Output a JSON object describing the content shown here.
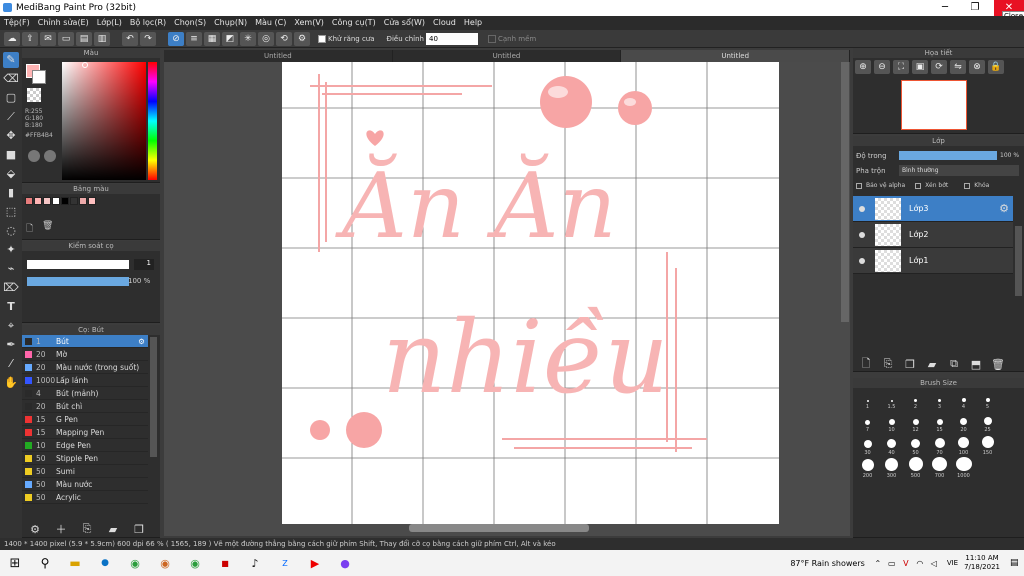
{
  "window": {
    "title": "MediBang Paint Pro (32bit)",
    "close_tooltip": "Close"
  },
  "menu": [
    "Tệp(F)",
    "Chỉnh sửa(E)",
    "Lớp(L)",
    "Bộ lọc(R)",
    "Chọn(S)",
    "Chụp(N)",
    "Màu (C)",
    "Xem(V)",
    "Công cụ(T)",
    "Cửa sổ(W)",
    "Cloud",
    "Help"
  ],
  "toolbar": {
    "antialias_label": "Khử răng cưa",
    "adjust_label": "Điều chỉnh",
    "adjust_value": "40",
    "edge_label": "Cạnh mềm"
  },
  "tabs": [
    "Untitled",
    "Untitled",
    "Untitled"
  ],
  "color_panel": {
    "title": "Màu",
    "r": "R:255",
    "g": "G:180",
    "b": "B:180",
    "hex": "#FFB4B4",
    "fg_color": "#ffb4b4",
    "bg_color": "#ffffff"
  },
  "palette_panel": {
    "title": "Bảng màu",
    "swatches": [
      "#e77c7c",
      "#ffb4b4",
      "#f6c6c6",
      "#ffffff",
      "#000000",
      "#333333",
      "#eeaaaa",
      "#ffc0c0"
    ]
  },
  "brush_control": {
    "title": "Kiểm soát cọ",
    "size": "1",
    "opacity": "100 %"
  },
  "brush_panel": {
    "title": "Cọ: Bút",
    "items": [
      {
        "size": "1",
        "name": "Bút",
        "color": "#2a2a2a",
        "active": true
      },
      {
        "size": "20",
        "name": "Mờ",
        "color": "#ff66aa"
      },
      {
        "size": "20",
        "name": "Màu nước (trong suốt)",
        "color": "#66aaff"
      },
      {
        "size": "1000",
        "name": "Lấp lánh",
        "color": "#3355ff"
      },
      {
        "size": "4",
        "name": "Bút (mảnh)",
        "color": "#2a2a2a"
      },
      {
        "size": "20",
        "name": "Bút chì",
        "color": "#2a2a2a"
      },
      {
        "size": "15",
        "name": "G Pen",
        "color": "#ee3333"
      },
      {
        "size": "15",
        "name": "Mapping Pen",
        "color": "#ee3333"
      },
      {
        "size": "10",
        "name": "Edge Pen",
        "color": "#22aa22"
      },
      {
        "size": "50",
        "name": "Stipple Pen",
        "color": "#eecc22"
      },
      {
        "size": "50",
        "name": "Sumi",
        "color": "#eecc22"
      },
      {
        "size": "50",
        "name": "Màu nước",
        "color": "#66aaff"
      },
      {
        "size": "50",
        "name": "Acrylic",
        "color": "#eecc22"
      }
    ]
  },
  "navigator": {
    "title": "Họa tiết"
  },
  "layer_panel": {
    "title": "Lớp",
    "opacity_label": "Độ trong",
    "opacity_value": "100 %",
    "blend_label": "Pha trộn",
    "blend_value": "Bình thường",
    "protect_alpha": "Bảo vệ alpha",
    "clipping": "Xén bớt",
    "lock": "Khóa",
    "layers": [
      {
        "name": "Lớp3",
        "active": true
      },
      {
        "name": "Lớp2"
      },
      {
        "name": "Lớp1"
      }
    ]
  },
  "brush_size_panel": {
    "title": "Brush Size",
    "sizes": [
      "1",
      "1.5",
      "2",
      "3",
      "4",
      "5",
      "7",
      "10",
      "12",
      "15",
      "20",
      "25",
      "30",
      "40",
      "50",
      "70",
      "100",
      "150",
      "200",
      "300",
      "500",
      "700",
      "1000"
    ]
  },
  "canvas_text": {
    "line1": "Ăn Ăn",
    "line2": "nhiều"
  },
  "status": "1400 * 1400 pixel   (5.9 * 5.9cm)   600 dpi   66 %   ( 1565, 189 )   Vẽ một đường thẳng bằng cách giữ phím Shift, Thay đổi cỡ cọ bằng cách giữ phím Ctrl, Alt và kéo",
  "taskbar": {
    "weather": "87°F  Rain showers",
    "lang": "VIE",
    "time": "11:10 AM",
    "date": "7/18/2021"
  }
}
